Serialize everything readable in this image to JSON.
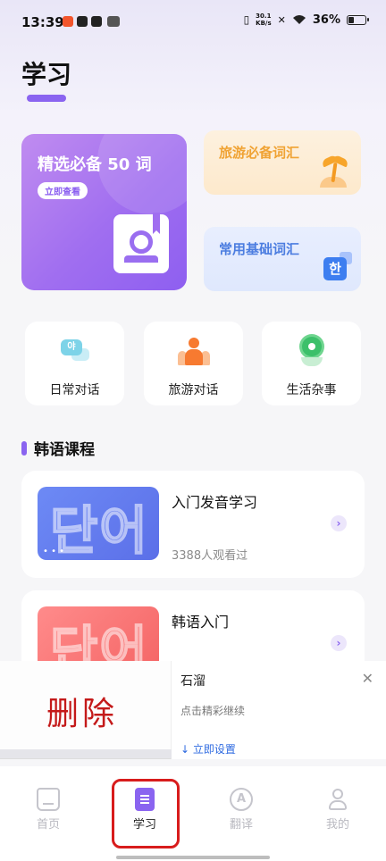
{
  "status_bar": {
    "time": "13:39",
    "net_speed_value": "30.1",
    "net_speed_unit": "KB/s",
    "battery": "36%",
    "battery_level": 0.36
  },
  "page": {
    "title": "学习"
  },
  "featured": {
    "main_title": "精选必备 50 词",
    "main_button": "立即查看",
    "travel_title": "旅游必备词汇",
    "common_title": "常用基础词汇",
    "hangul_glyph": "한"
  },
  "quick_entries": [
    {
      "label": "日常对话",
      "icon": "chat-bubble-icon",
      "glyph": "야"
    },
    {
      "label": "旅游对话",
      "icon": "people-icon"
    },
    {
      "label": "生活杂事",
      "icon": "flower-icon"
    }
  ],
  "courses_section": {
    "title": "韩语课程"
  },
  "courses": [
    {
      "title": "入门发音学习",
      "views": "3388人观看过",
      "thumb_text": "단어",
      "thumb_color": "#6478ee"
    },
    {
      "title": "韩语入门",
      "views": "",
      "thumb_text": "단어",
      "thumb_color": "#f46c6c"
    }
  ],
  "ad": {
    "image_text": "删除",
    "name": "石溜",
    "desc": "点击精彩继续",
    "cta": "↓ 立即设置",
    "close": "✕"
  },
  "tabbar": {
    "tabs": [
      {
        "label": "首页",
        "active": false
      },
      {
        "label": "学习",
        "active": true
      },
      {
        "label": "翻译",
        "active": false,
        "glyph": "A"
      },
      {
        "label": "我的",
        "active": false
      }
    ]
  },
  "colors": {
    "accent": "#8a64f0",
    "highlight": "#d81c1c"
  }
}
